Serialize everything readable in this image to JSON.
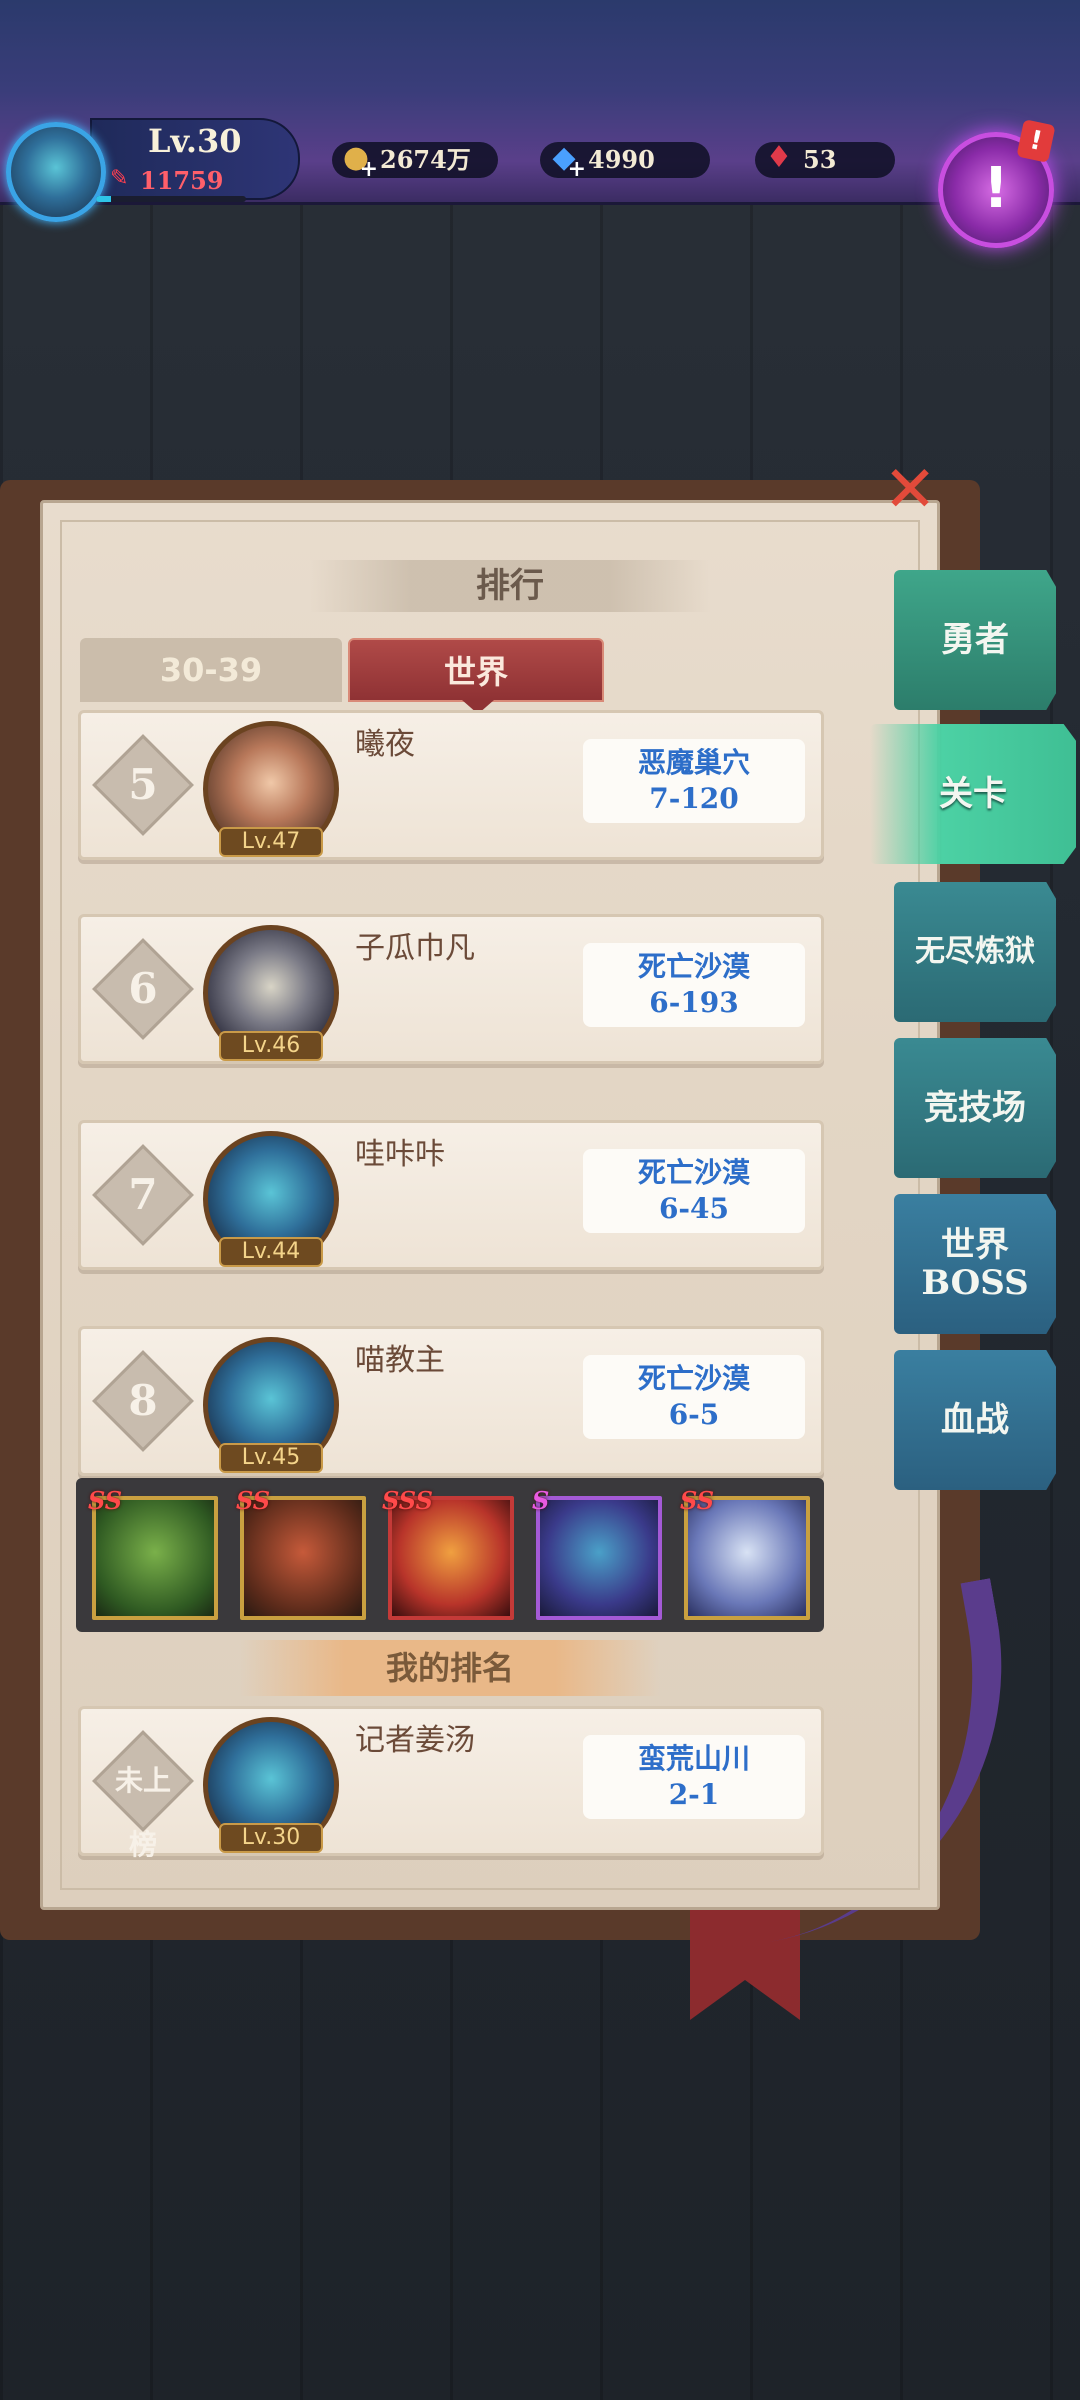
{
  "player": {
    "level": "Lv.30",
    "power": "11759",
    "xp_fraction": 0.1
  },
  "resources": {
    "gold": "2674万",
    "gems": "4990",
    "rubies": "53"
  },
  "ranking": {
    "title": "排行",
    "tabs": [
      "30-39",
      "世界"
    ],
    "active_tab": "世界",
    "entries": [
      {
        "rank": "5",
        "name": "曦夜",
        "level": "Lv.47",
        "stage_name": "恶魔巢穴",
        "stage_num": "7-120"
      },
      {
        "rank": "6",
        "name": "子瓜巾凡",
        "level": "Lv.46",
        "stage_name": "死亡沙漠",
        "stage_num": "6-193"
      },
      {
        "rank": "7",
        "name": "哇咔咔",
        "level": "Lv.44",
        "stage_name": "死亡沙漠",
        "stage_num": "6-45"
      },
      {
        "rank": "8",
        "name": "喵教主",
        "level": "Lv.45",
        "stage_name": "死亡沙漠",
        "stage_num": "6-5"
      }
    ],
    "heroes": [
      {
        "grade": "SS",
        "name": "treant"
      },
      {
        "grade": "SS",
        "name": "orc-warrior"
      },
      {
        "grade": "SSS",
        "name": "fire-demon"
      },
      {
        "grade": "S",
        "name": "dragon-knight"
      },
      {
        "grade": "SS",
        "name": "ice-maiden"
      }
    ],
    "my_rank_title": "我的排名",
    "my_entry": {
      "rank": "未上榜",
      "name": "记者姜汤",
      "level": "Lv.30",
      "stage_name": "蛮荒山川",
      "stage_num": "2-1"
    }
  },
  "side_tabs": {
    "hero": "勇者",
    "stage": "关卡",
    "endless_line1": "无尽炼狱",
    "arena": "竞技场",
    "boss_line1": "世界",
    "boss_line2": "BOSS",
    "bloodbattle": "血战"
  },
  "active_side_tab": "关卡"
}
